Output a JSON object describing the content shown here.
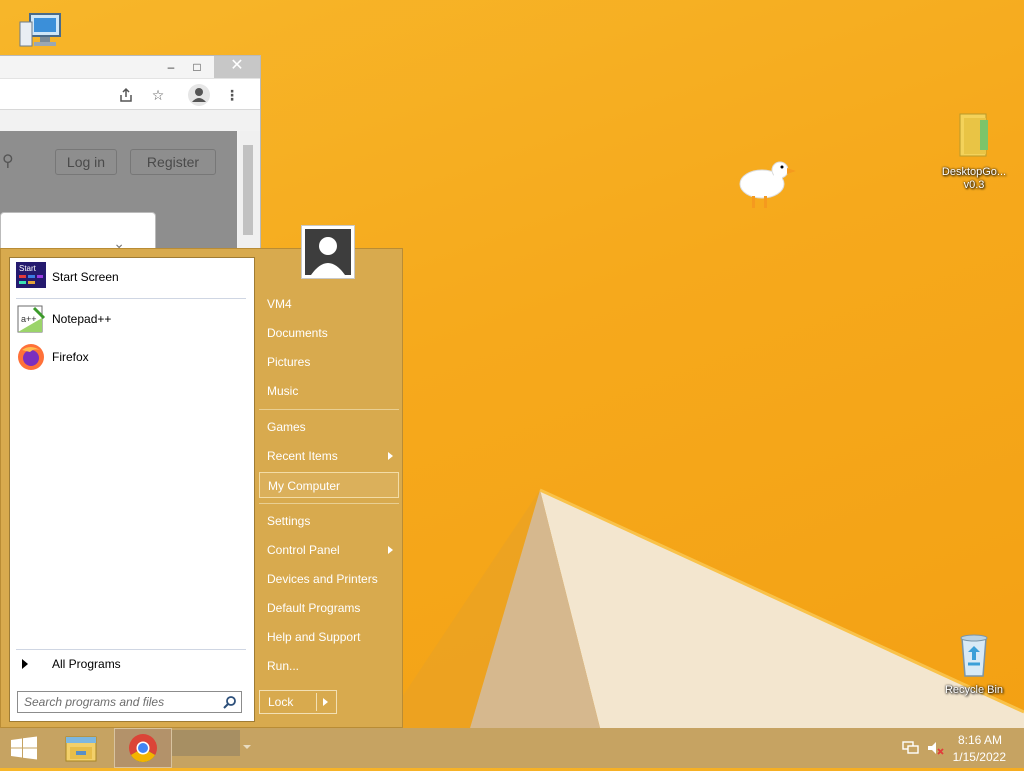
{
  "desktop": {
    "icons": [
      {
        "label": ""
      },
      {
        "label": "DesktopGo... v0.3"
      },
      {
        "label": "Recycle Bin"
      }
    ]
  },
  "browser": {
    "minimize": "–",
    "maximize": "□",
    "close": "✕",
    "login": "Log in",
    "register": "Register"
  },
  "start_menu": {
    "programs": [
      {
        "label": "Start Screen",
        "icon": "start-screen-icon"
      },
      {
        "label": "Notepad++",
        "icon": "notepadpp-icon"
      },
      {
        "label": "Firefox",
        "icon": "firefox-icon"
      }
    ],
    "all_programs": "All Programs",
    "search_placeholder": "Search programs and files",
    "right_items": [
      {
        "label": "VM4"
      },
      {
        "label": "Documents"
      },
      {
        "label": "Pictures"
      },
      {
        "label": "Music"
      },
      {
        "label": "Games"
      },
      {
        "label": "Recent Items",
        "submenu": true
      },
      {
        "label": "My Computer",
        "selected": true
      },
      {
        "label": "Settings"
      },
      {
        "label": "Control Panel",
        "submenu": true
      },
      {
        "label": "Devices and Printers"
      },
      {
        "label": "Default Programs"
      },
      {
        "label": "Help and Support"
      },
      {
        "label": "Run..."
      }
    ],
    "lock": "Lock"
  },
  "taskbar": {
    "time": "8:16 AM",
    "date": "1/15/2022"
  }
}
